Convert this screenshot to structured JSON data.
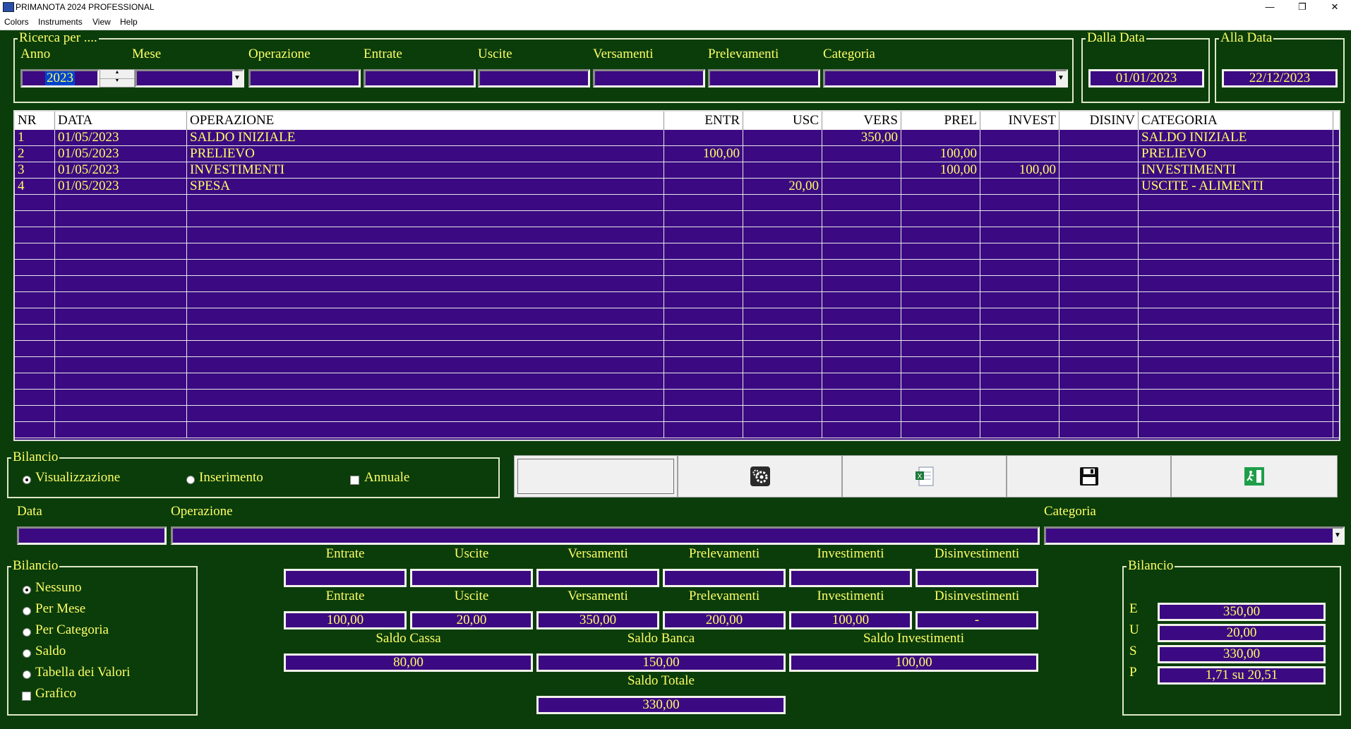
{
  "window": {
    "title": "PRIMANOTA 2024 PROFESSIONAL",
    "minimize": "—",
    "maximize": "❐",
    "close": "✕"
  },
  "menu": [
    "Colors",
    "Instruments",
    "View",
    "Help"
  ],
  "search": {
    "legend": "Ricerca per ....",
    "labels": {
      "anno": "Anno",
      "mese": "Mese",
      "operazione": "Operazione",
      "entrate": "Entrate",
      "uscite": "Uscite",
      "versamenti": "Versamenti",
      "prelevamenti": "Prelevamenti",
      "categoria": "Categoria"
    },
    "anno_value": "2023",
    "mese_value": "",
    "categoria_value": ""
  },
  "dates": {
    "from_legend": "Dalla Data",
    "from_value": "01/01/2023",
    "to_legend": "Alla Data",
    "to_value": "22/12/2023"
  },
  "table": {
    "columns": [
      "NR",
      "DATA",
      "OPERAZIONE",
      "ENTR",
      "USC",
      "VERS",
      "PREL",
      "INVEST",
      "DISINV",
      "CATEGORIA"
    ],
    "rows": [
      [
        "1",
        "01/05/2023",
        "SALDO INIZIALE",
        "",
        "",
        "350,00",
        "",
        "",
        "",
        "SALDO INIZIALE"
      ],
      [
        "2",
        "01/05/2023",
        "PRELIEVO",
        "100,00",
        "",
        "",
        "100,00",
        "",
        "",
        "PRELIEVO"
      ],
      [
        "3",
        "01/05/2023",
        "INVESTIMENTI",
        "",
        "",
        "",
        "100,00",
        "100,00",
        "",
        "INVESTIMENTI"
      ],
      [
        "4",
        "01/05/2023",
        "SPESA",
        "",
        "20,00",
        "",
        "",
        "",
        "",
        "USCITE - ALIMENTI"
      ]
    ],
    "empty_rows": 15
  },
  "bilancio_mode": {
    "legend": "Bilancio",
    "visualizzazione": "Visualizzazione",
    "inserimento": "Inserimento",
    "annuale": "Annuale"
  },
  "icons": {
    "settings": "gear-icon",
    "export": "excel-icon",
    "save": "floppy-disk-icon",
    "exit": "exit-door-icon"
  },
  "entry": {
    "data_label": "Data",
    "operazione_label": "Operazione",
    "categoria_label": "Categoria"
  },
  "amounts": {
    "labels": [
      "Entrate",
      "Uscite",
      "Versamenti",
      "Prelevamenti",
      "Investimenti",
      "Disinvestimenti"
    ],
    "totals_labels": [
      "Entrate",
      "Uscite",
      "Versamenti",
      "Prelevamenti",
      "Investimenti",
      "Disinvestimenti"
    ],
    "totals_values": [
      "100,00",
      "20,00",
      "350,00",
      "200,00",
      "100,00",
      "-"
    ],
    "saldo_cassa_label": "Saldo Cassa",
    "saldo_cassa": "80,00",
    "saldo_banca_label": "Saldo Banca",
    "saldo_banca": "150,00",
    "saldo_invest_label": "Saldo Investimenti",
    "saldo_invest": "100,00",
    "saldo_totale_label": "Saldo Totale",
    "saldo_totale": "330,00"
  },
  "report": {
    "legend": "Bilancio",
    "options": [
      "Nessuno",
      "Per Mese",
      "Per Categoria",
      "Saldo",
      "Tabella dei Valori"
    ],
    "grafico": "Grafico"
  },
  "summary": {
    "legend": "Bilancio",
    "letters": [
      "E",
      "U",
      "S",
      "P"
    ],
    "values": [
      "350,00",
      "20,00",
      "330,00",
      "1,71 su 20,51"
    ]
  },
  "colors": {
    "background": "#0a3d0a",
    "field": "#3b0a82",
    "text": "#ffff66"
  }
}
